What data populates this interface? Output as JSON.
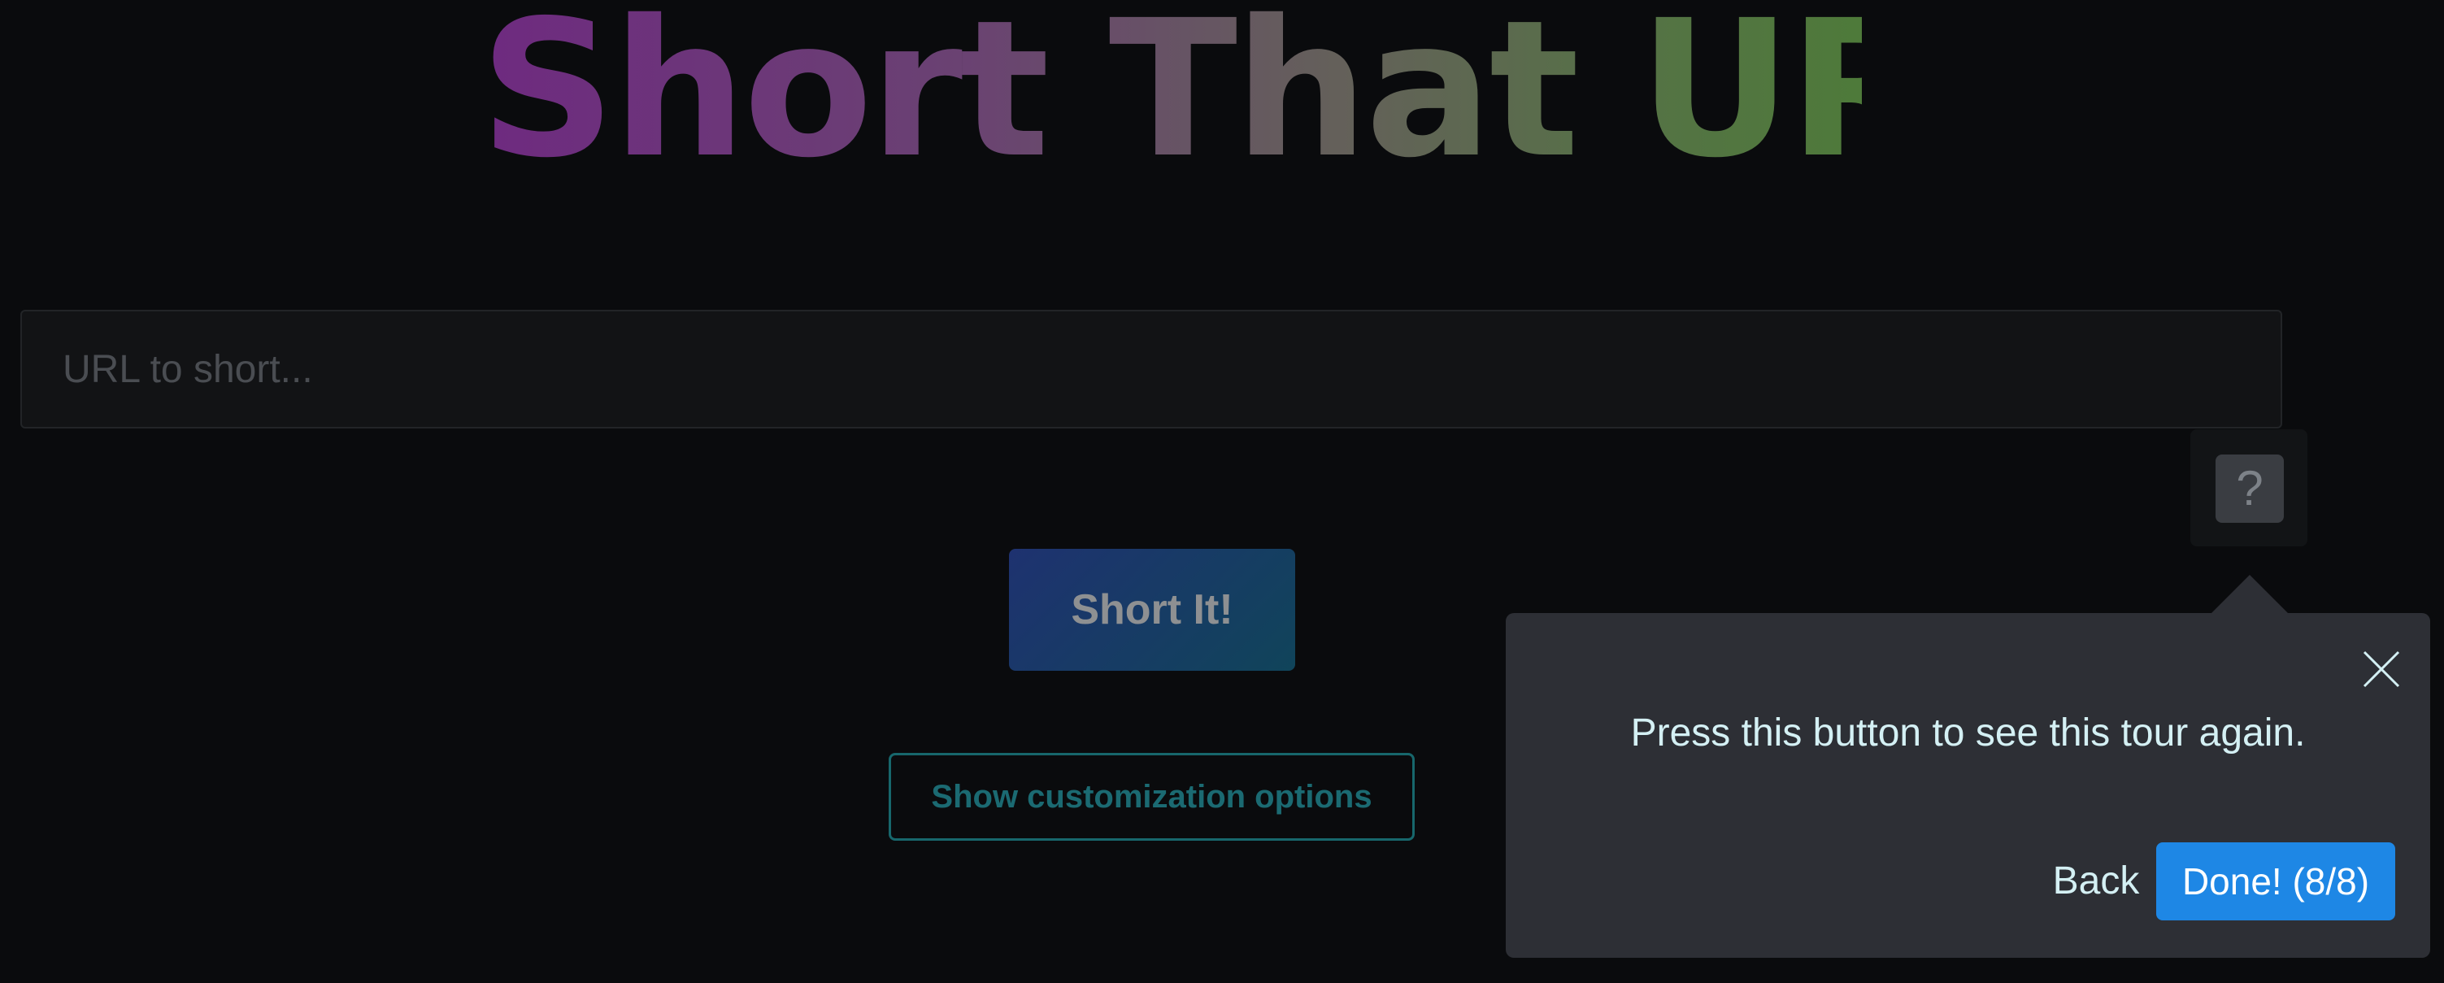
{
  "header": {
    "title": "Short That URL!"
  },
  "form": {
    "url_placeholder": "URL to short...",
    "short_button": "Short It!",
    "customize_button": "Show customization options"
  },
  "help": {
    "label": "?"
  },
  "tour": {
    "message": "Press this button to see this tour again.",
    "back_label": "Back",
    "done_label": "Done! (8/8)",
    "step_current": 8,
    "step_total": 8
  },
  "colors": {
    "background": "#0a0b0d",
    "popover": "#2d2f35",
    "done_button": "#1e87e5",
    "customize_border": "#17676c",
    "title_gradient_start": "#6e2a80",
    "title_gradient_end": "#4e7a3a"
  },
  "icons": {
    "close": "close-icon",
    "help": "question-mark-icon"
  }
}
